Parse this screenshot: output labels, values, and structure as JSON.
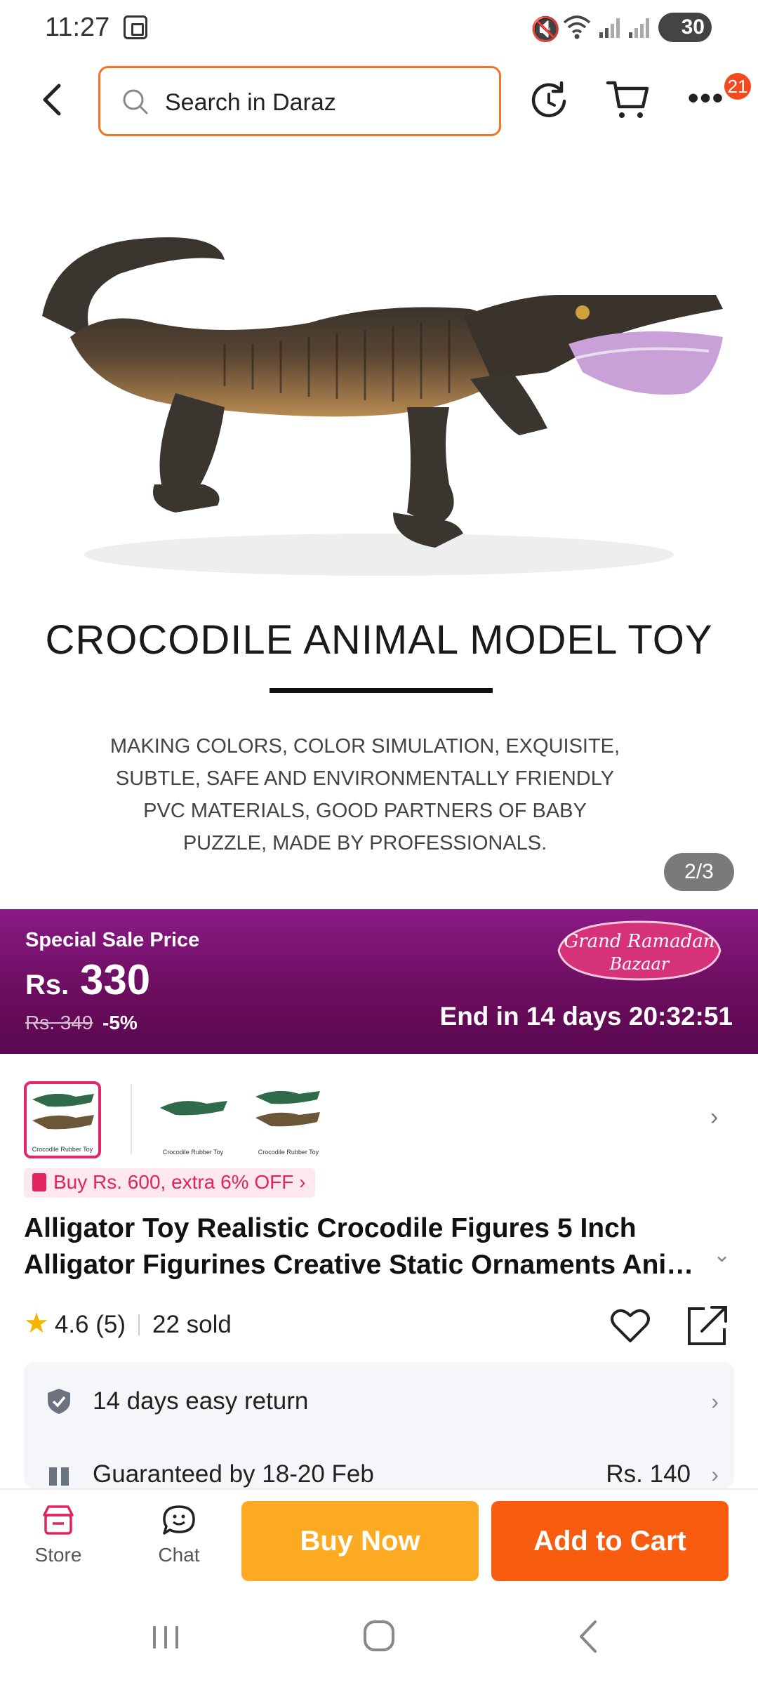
{
  "status_bar": {
    "time": "11:27",
    "battery": "30"
  },
  "search": {
    "placeholder": "Search in Daraz"
  },
  "topbar": {
    "notification_count": "21"
  },
  "hero": {
    "headline": "CROCODILE ANIMAL MODEL TOY",
    "description_lines": [
      "MAKING COLORS, COLOR SIMULATION, EXQUISITE,",
      "SUBTLE, SAFE AND ENVIRONMENTALLY FRIENDLY",
      "PVC MATERIALS, GOOD PARTNERS OF BABY",
      "PUZZLE, MADE BY PROFESSIONALS."
    ],
    "image_counter": "2/3"
  },
  "sale": {
    "label": "Special Sale Price",
    "currency": "Rs.",
    "price": "330",
    "original_price": "Rs. 349",
    "discount": "-5%",
    "countdown": "End in 14 days 20:32:51",
    "campaign_line1": "Grand Ramadan",
    "campaign_line2": "Bazaar"
  },
  "thumbnails": {
    "caption": "Crocodile Rubber Toy"
  },
  "promo": {
    "text": "Buy Rs. 600, extra 6% OFF"
  },
  "product": {
    "title_line1": "Alligator Toy Realistic Crocodile Figures 5 Inch",
    "title_line2": "Alligator Figurines Creative Static Ornaments Animal Model",
    "rating": "4.6",
    "reviews": "(5)",
    "sold": "22 sold"
  },
  "service": {
    "return_text": "14 days easy return",
    "delivery_text": "Guaranteed by 18-20 Feb",
    "delivery_fee": "Rs. 140"
  },
  "actions": {
    "store": "Store",
    "chat": "Chat",
    "buy_now": "Buy Now",
    "add_to_cart": "Add to Cart"
  },
  "colors": {
    "accent": "#f57224",
    "buy_now": "#fbaa22",
    "add_to_cart": "#f85c0f",
    "sale_banner": "#7a1170",
    "promo": "#e0245e"
  }
}
